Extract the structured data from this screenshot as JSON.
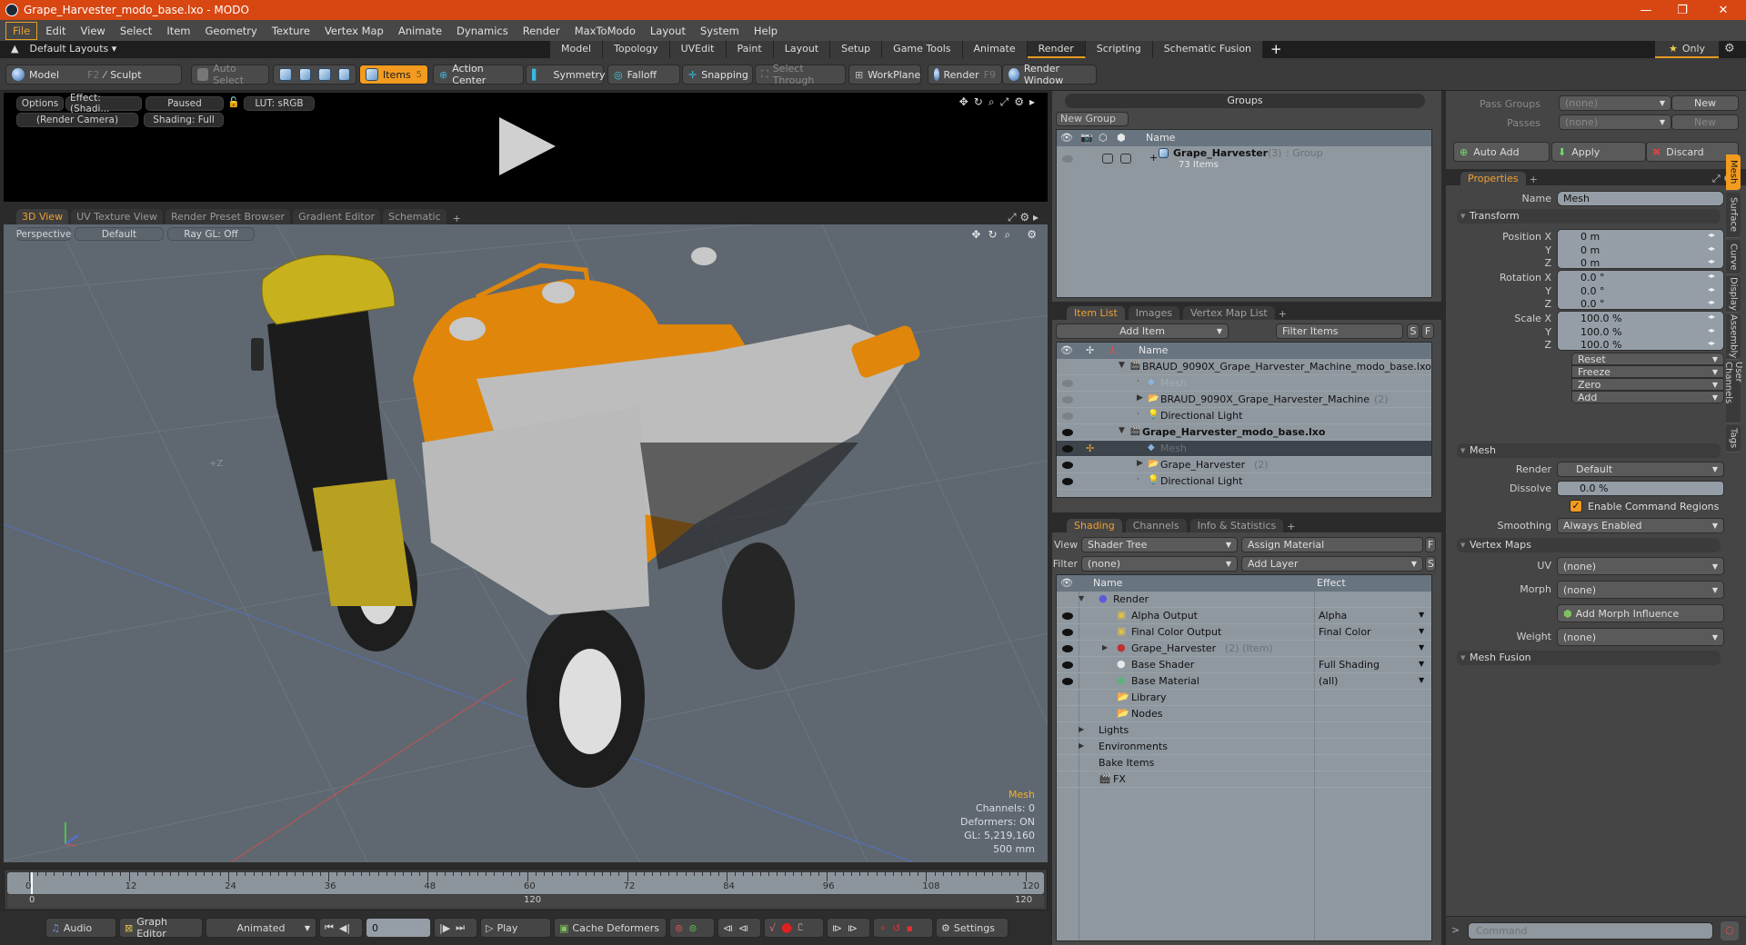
{
  "window": {
    "title": "Grape_Harvester_modo_base.lxo - MODO"
  },
  "menu": [
    "File",
    "Edit",
    "View",
    "Select",
    "Item",
    "Geometry",
    "Texture",
    "Vertex Map",
    "Animate",
    "Dynamics",
    "Render",
    "MaxToModo",
    "Layout",
    "System",
    "Help"
  ],
  "layout_bar": {
    "layouts_label": "Default Layouts ▾",
    "tabs": [
      "Model",
      "Topology",
      "UVEdit",
      "Paint",
      "Layout",
      "Setup",
      "Game Tools",
      "Animate",
      "Render",
      "Scripting",
      "Schematic Fusion"
    ],
    "active_tab": "Render",
    "only_label": "Only"
  },
  "toolbar": {
    "model": "Model",
    "model_key": "F2",
    "sculpt": "Sculpt",
    "auto_select": "Auto Select",
    "items": "Items",
    "items_count": "5",
    "action_center": "Action Center",
    "symmetry": "Symmetry",
    "falloff": "Falloff",
    "snapping": "Snapping",
    "select_through": "Select Through",
    "workplane": "WorkPlane",
    "render": "Render",
    "render_key": "F9",
    "render_window": "Render Window"
  },
  "render_preview": {
    "options": "Options",
    "effect": "Effect: (Shadi...",
    "paused": "Paused",
    "lut": "LUT: sRGB",
    "camera": "(Render Camera)",
    "shading": "Shading: Full"
  },
  "viewport_tabs": [
    "3D View",
    "UV Texture View",
    "Render Preset Browser",
    "Gradient Editor",
    "Schematic"
  ],
  "viewport": {
    "projection": "Perspective",
    "style": "Default",
    "raygl": "Ray GL: Off",
    "axis_label": "+Z",
    "hud": {
      "title": "Mesh",
      "channels": "Channels: 0",
      "deformers": "Deformers: ON",
      "gl": "GL: 5,219,160",
      "scale": "500 mm"
    },
    "accent": "#f0b030"
  },
  "timeline": {
    "ticks": [
      "0",
      "12",
      "24",
      "36",
      "48",
      "60",
      "72",
      "84",
      "96",
      "108",
      "120"
    ],
    "range_start": "0",
    "range_mid": "120",
    "range_end": "120"
  },
  "bottom_bar": {
    "audio": "Audio",
    "graph_editor": "Graph Editor",
    "animated": "Animated",
    "frame": "0",
    "play": "Play",
    "cache_deformers": "Cache Deformers",
    "settings": "Settings"
  },
  "groups": {
    "title": "Groups",
    "new_group": "New Group",
    "col_name": "Name",
    "rows": [
      {
        "name": "Grape_Harvester",
        "count": "(3)",
        "type": ": Group",
        "sub": "73 Items"
      }
    ]
  },
  "item_list": {
    "tabs": [
      "Item List",
      "Images",
      "Vertex Map List"
    ],
    "add_item": "Add Item",
    "filter": "Filter Items",
    "s": "S",
    "f": "F",
    "col_name": "Name",
    "rows": [
      {
        "name": "BRAUD_9090X_Grape_Harvester_Machine_modo_base.lxo",
        "suffix": "",
        "kind": "scene",
        "indent": 0,
        "dim": false,
        "bold": false
      },
      {
        "name": "Mesh",
        "suffix": "",
        "kind": "mesh",
        "indent": 1,
        "dim": true,
        "bold": false
      },
      {
        "name": "BRAUD_9090X_Grape_Harvester_Machine",
        "suffix": "(2)",
        "kind": "folder",
        "indent": 1,
        "dim": false,
        "bold": false
      },
      {
        "name": "Directional Light",
        "suffix": "",
        "kind": "light",
        "indent": 1,
        "dim": false,
        "bold": false
      },
      {
        "name": "Grape_Harvester_modo_base.lxo",
        "suffix": "",
        "kind": "scene",
        "indent": 0,
        "dim": false,
        "bold": true
      },
      {
        "name": "Mesh",
        "suffix": "",
        "kind": "mesh",
        "indent": 1,
        "dim": true,
        "bold": false,
        "selected": true
      },
      {
        "name": "Grape_Harvester",
        "suffix": "(2)",
        "kind": "folder",
        "indent": 1,
        "dim": false,
        "bold": false
      },
      {
        "name": "Directional Light",
        "suffix": "",
        "kind": "light",
        "indent": 1,
        "dim": false,
        "bold": false
      }
    ]
  },
  "shading": {
    "tabs": [
      "Shading",
      "Channels",
      "Info & Statistics"
    ],
    "view_label": "View",
    "view_value": "Shader Tree",
    "assign_material": "Assign Material",
    "filter_label": "Filter",
    "filter_value": "(none)",
    "add_layer": "Add Layer",
    "f": "F",
    "s": "S",
    "col_name": "Name",
    "col_effect": "Effect",
    "rows": [
      {
        "name": "Render",
        "effect": "",
        "icon": "render-sphere",
        "indent": 0
      },
      {
        "name": "Alpha Output",
        "effect": "Alpha",
        "icon": "output",
        "indent": 1
      },
      {
        "name": "Final Color Output",
        "effect": "Final Color",
        "icon": "output",
        "indent": 1
      },
      {
        "name": "Grape_Harvester",
        "suffix": "(2) (Item)",
        "effect": "",
        "icon": "material-group",
        "indent": 1
      },
      {
        "name": "Base Shader",
        "effect": "Full Shading",
        "icon": "shader",
        "indent": 1
      },
      {
        "name": "Base Material",
        "effect": "(all)",
        "icon": "material",
        "indent": 1
      },
      {
        "name": "Library",
        "effect": "",
        "icon": "folder",
        "indent": 1
      },
      {
        "name": "Nodes",
        "effect": "",
        "icon": "folder",
        "indent": 1
      },
      {
        "name": "Lights",
        "effect": "",
        "icon": "",
        "indent": 0
      },
      {
        "name": "Environments",
        "effect": "",
        "icon": "",
        "indent": 0
      },
      {
        "name": "Bake Items",
        "effect": "",
        "icon": "",
        "indent": 0
      },
      {
        "name": "FX",
        "effect": "",
        "icon": "scene",
        "indent": 0
      }
    ]
  },
  "passes": {
    "pass_groups_label": "Pass Groups",
    "pass_groups_value": "(none)",
    "new": "New",
    "passes_label": "Passes",
    "passes_value": "(none)",
    "auto_add": "Auto Add",
    "apply": "Apply",
    "discard": "Discard"
  },
  "properties": {
    "tab": "Properties",
    "name_label": "Name",
    "name_value": "Mesh",
    "transform_title": "Transform",
    "position": [
      {
        "label": "Position X",
        "value": "0 m"
      },
      {
        "label": "Y",
        "value": "0 m"
      },
      {
        "label": "Z",
        "value": "0 m"
      }
    ],
    "rotation": [
      {
        "label": "Rotation X",
        "value": "0.0 °"
      },
      {
        "label": "Y",
        "value": "0.0 °"
      },
      {
        "label": "Z",
        "value": "0.0 °"
      }
    ],
    "scale": [
      {
        "label": "Scale X",
        "value": "100.0 %"
      },
      {
        "label": "Y",
        "value": "100.0 %"
      },
      {
        "label": "Z",
        "value": "100.0 %"
      }
    ],
    "actions": [
      "Reset",
      "Freeze",
      "Zero",
      "Add"
    ],
    "mesh_title": "Mesh",
    "render_label": "Render",
    "render_value": "Default",
    "dissolve_label": "Dissolve",
    "dissolve_value": "0.0 %",
    "enable_cmd_regions": "Enable Command Regions",
    "enable_cmd_regions_checked": true,
    "smoothing_label": "Smoothing",
    "smoothing_value": "Always Enabled",
    "vertex_maps_title": "Vertex Maps",
    "uv_label": "UV",
    "uv_value": "(none)",
    "morph_label": "Morph",
    "morph_value": "(none)",
    "add_morph": "Add Morph Influence",
    "weight_label": "Weight",
    "weight_value": "(none)",
    "mesh_fusion_title": "Mesh Fusion",
    "side_tabs": [
      "Mesh",
      "Surface",
      "Curve",
      "Display",
      "Assembly",
      "User Channels",
      "Tags"
    ]
  },
  "command": {
    "placeholder": "Command"
  }
}
